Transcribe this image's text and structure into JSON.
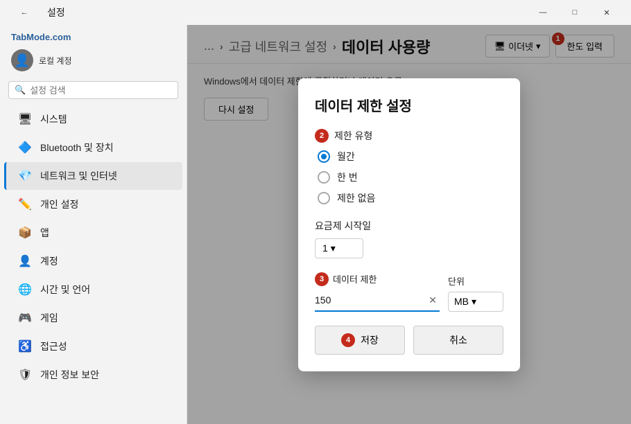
{
  "window": {
    "title": "설정",
    "controls": {
      "minimize": "—",
      "maximize": "□",
      "close": "✕"
    }
  },
  "sidebar": {
    "brand": "TabMode.com",
    "account_label": "로컬 계정",
    "search_placeholder": "설정 검색",
    "nav_items": [
      {
        "id": "system",
        "icon": "🖥",
        "label": "시스템"
      },
      {
        "id": "bluetooth",
        "icon": "🔷",
        "label": "Bluetooth 및 장치"
      },
      {
        "id": "network",
        "icon": "💎",
        "label": "네트워크 및 인터넷"
      },
      {
        "id": "personalize",
        "icon": "✏️",
        "label": "개인 설정"
      },
      {
        "id": "apps",
        "icon": "📦",
        "label": "앱"
      },
      {
        "id": "accounts",
        "icon": "👤",
        "label": "계정"
      },
      {
        "id": "time",
        "icon": "🌐",
        "label": "시간 및 언어"
      },
      {
        "id": "gaming",
        "icon": "🎮",
        "label": "게임"
      },
      {
        "id": "accessibility",
        "icon": "♿",
        "label": "접근성"
      },
      {
        "id": "privacy",
        "icon": "🛡",
        "label": "개인 정보 보안"
      }
    ]
  },
  "content": {
    "breadcrumb": {
      "separator": "›",
      "parts": [
        "...",
        "고급 네트워크 설정"
      ],
      "current": "데이터 사용량"
    },
    "dropdown": {
      "icon": "🖥",
      "label": "이더넷",
      "chevron": "▾"
    },
    "limit_input_btn": {
      "label": "한도 입력",
      "badge": "1"
    },
    "info_text": "Windows에서 데이터 제한에 근접하거나 데이터 요금",
    "reset_btn": "다시 설정"
  },
  "dialog": {
    "title": "데이터 제한 설정",
    "limit_type_label": "제한 유형",
    "limit_type_badge": "2",
    "radio_options": [
      {
        "id": "monthly",
        "label": "월간",
        "selected": true
      },
      {
        "id": "once",
        "label": "한 번",
        "selected": false
      },
      {
        "id": "none",
        "label": "제한 없음",
        "selected": false
      }
    ],
    "start_date_label": "요금제 시작일",
    "start_date_value": "1",
    "start_date_chevron": "▾",
    "data_limit_label": "데이터 제한",
    "data_limit_value": "150",
    "data_limit_badge": "3",
    "unit_label": "단위",
    "unit_value": "MB",
    "unit_chevron": "▾",
    "save_btn": "저장",
    "save_btn_badge": "4",
    "cancel_btn": "취소"
  }
}
